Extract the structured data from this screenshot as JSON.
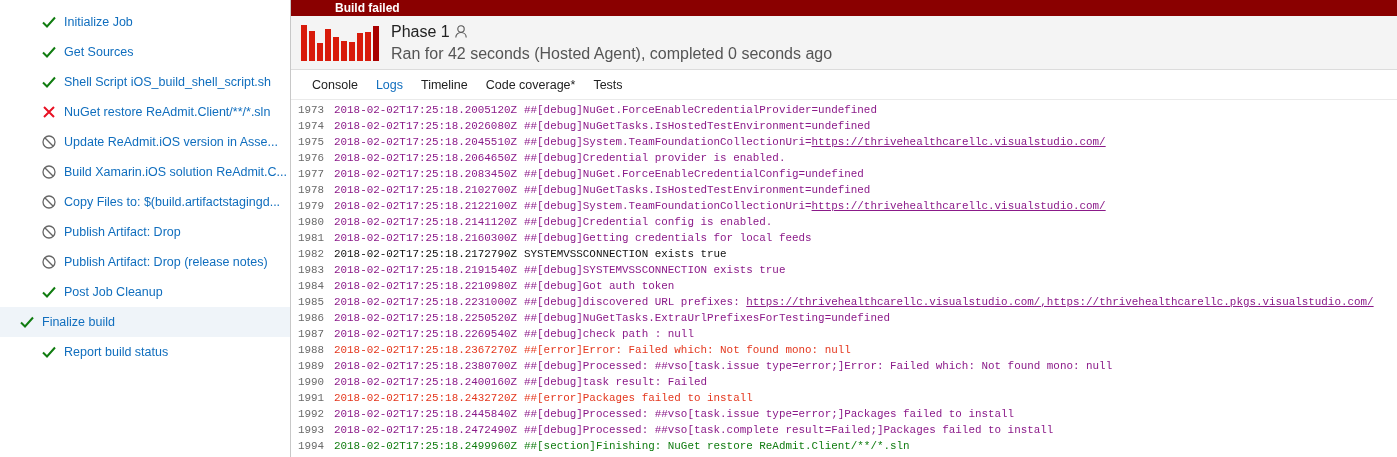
{
  "banner": {
    "title": "Build failed"
  },
  "steps": [
    {
      "label": "Initialize Job",
      "kind": "succeeded",
      "selected": false
    },
    {
      "label": "Get Sources",
      "kind": "succeeded",
      "selected": false
    },
    {
      "label": "Shell Script iOS_build_shell_script.sh",
      "kind": "succeeded",
      "selected": false
    },
    {
      "label": "NuGet restore ReAdmit.Client/**/*.sln",
      "kind": "failed",
      "selected": false
    },
    {
      "label": "Update ReAdmit.iOS version in Asse...",
      "kind": "skipped",
      "selected": false
    },
    {
      "label": "Build Xamarin.iOS solution ReAdmit.C...",
      "kind": "skipped",
      "selected": false
    },
    {
      "label": "Copy Files to: $(build.artifactstagingd...",
      "kind": "skipped",
      "selected": false
    },
    {
      "label": "Publish Artifact: Drop",
      "kind": "skipped",
      "selected": false
    },
    {
      "label": "Publish Artifact: Drop (release notes)",
      "kind": "skipped",
      "selected": false
    },
    {
      "label": "Post Job Cleanup",
      "kind": "succeeded",
      "selected": false
    },
    {
      "label": "Finalize build",
      "kind": "succeeded",
      "selected": true
    },
    {
      "label": "Report build status",
      "kind": "succeeded",
      "selected": false
    }
  ],
  "phase": {
    "title": "Phase 1",
    "summary": "Ran for 42 seconds (Hosted Agent), completed 0 seconds ago"
  },
  "tabs": [
    {
      "label": "Console",
      "selected": false
    },
    {
      "label": "Logs",
      "selected": true
    },
    {
      "label": "Timeline",
      "selected": false
    },
    {
      "label": "Code coverage*",
      "selected": false
    },
    {
      "label": "Tests",
      "selected": false
    }
  ],
  "log": [
    {
      "number": "1973",
      "kind": "debug",
      "timestamp": "2018-02-02T17:25:18.2005120Z",
      "message": "##[debug]NuGet.ForceEnableCredentialProvider=undefined"
    },
    {
      "number": "1974",
      "kind": "debug",
      "timestamp": "2018-02-02T17:25:18.2026080Z",
      "message": "##[debug]NuGetTasks.IsHostedTestEnvironment=undefined"
    },
    {
      "number": "1975",
      "kind": "debug",
      "timestamp": "2018-02-02T17:25:18.2045510Z",
      "message": "##[debug]System.TeamFoundationCollectionUri=",
      "link": "https://thrivehealthcarellc.visualstudio.com/"
    },
    {
      "number": "1976",
      "kind": "debug",
      "timestamp": "2018-02-02T17:25:18.2064650Z",
      "message": "##[debug]Credential provider is enabled."
    },
    {
      "number": "1977",
      "kind": "debug",
      "timestamp": "2018-02-02T17:25:18.2083450Z",
      "message": "##[debug]NuGet.ForceEnableCredentialConfig=undefined"
    },
    {
      "number": "1978",
      "kind": "debug",
      "timestamp": "2018-02-02T17:25:18.2102700Z",
      "message": "##[debug]NuGetTasks.IsHostedTestEnvironment=undefined"
    },
    {
      "number": "1979",
      "kind": "debug",
      "timestamp": "2018-02-02T17:25:18.2122100Z",
      "message": "##[debug]System.TeamFoundationCollectionUri=",
      "link": "https://thrivehealthcarellc.visualstudio.com/"
    },
    {
      "number": "1980",
      "kind": "debug",
      "timestamp": "2018-02-02T17:25:18.2141120Z",
      "message": "##[debug]Credential config is enabled."
    },
    {
      "number": "1981",
      "kind": "debug",
      "timestamp": "2018-02-02T17:25:18.2160300Z",
      "message": "##[debug]Getting credentials for local feeds"
    },
    {
      "number": "1982",
      "kind": "info",
      "timestamp": "2018-02-02T17:25:18.2172790Z",
      "message": "SYSTEMVSSCONNECTION exists true"
    },
    {
      "number": "1983",
      "kind": "debug",
      "timestamp": "2018-02-02T17:25:18.2191540Z",
      "message": "##[debug]SYSTEMVSSCONNECTION exists true"
    },
    {
      "number": "1984",
      "kind": "debug",
      "timestamp": "2018-02-02T17:25:18.2210980Z",
      "message": "##[debug]Got auth token"
    },
    {
      "number": "1985",
      "kind": "debug",
      "timestamp": "2018-02-02T17:25:18.2231000Z",
      "message": "##[debug]discovered URL prefixes: ",
      "link": "https://thrivehealthcarellc.visualstudio.com/,https://thrivehealthcarellc.pkgs.visualstudio.com/"
    },
    {
      "number": "1986",
      "kind": "debug",
      "timestamp": "2018-02-02T17:25:18.2250520Z",
      "message": "##[debug]NuGetTasks.ExtraUrlPrefixesForTesting=undefined"
    },
    {
      "number": "1987",
      "kind": "debug",
      "timestamp": "2018-02-02T17:25:18.2269540Z",
      "message": "##[debug]check path : null"
    },
    {
      "number": "1988",
      "kind": "error",
      "timestamp": "2018-02-02T17:25:18.2367270Z",
      "message": "##[error]Error: Failed which: Not found mono: null"
    },
    {
      "number": "1989",
      "kind": "debug",
      "timestamp": "2018-02-02T17:25:18.2380700Z",
      "message": "##[debug]Processed: ##vso[task.issue type=error;]Error: Failed which: Not found mono: null"
    },
    {
      "number": "1990",
      "kind": "debug",
      "timestamp": "2018-02-02T17:25:18.2400160Z",
      "message": "##[debug]task result: Failed"
    },
    {
      "number": "1991",
      "kind": "error",
      "timestamp": "2018-02-02T17:25:18.2432720Z",
      "message": "##[error]Packages failed to install"
    },
    {
      "number": "1992",
      "kind": "debug",
      "timestamp": "2018-02-02T17:25:18.2445840Z",
      "message": "##[debug]Processed: ##vso[task.issue type=error;]Packages failed to install"
    },
    {
      "number": "1993",
      "kind": "debug",
      "timestamp": "2018-02-02T17:25:18.2472490Z",
      "message": "##[debug]Processed: ##vso[task.complete result=Failed;]Packages failed to install"
    },
    {
      "number": "1994",
      "kind": "section",
      "timestamp": "2018-02-02T17:25:18.2499960Z",
      "message": "##[section]Finishing: NuGet restore ReAdmit.Client/**/*.sln"
    }
  ]
}
